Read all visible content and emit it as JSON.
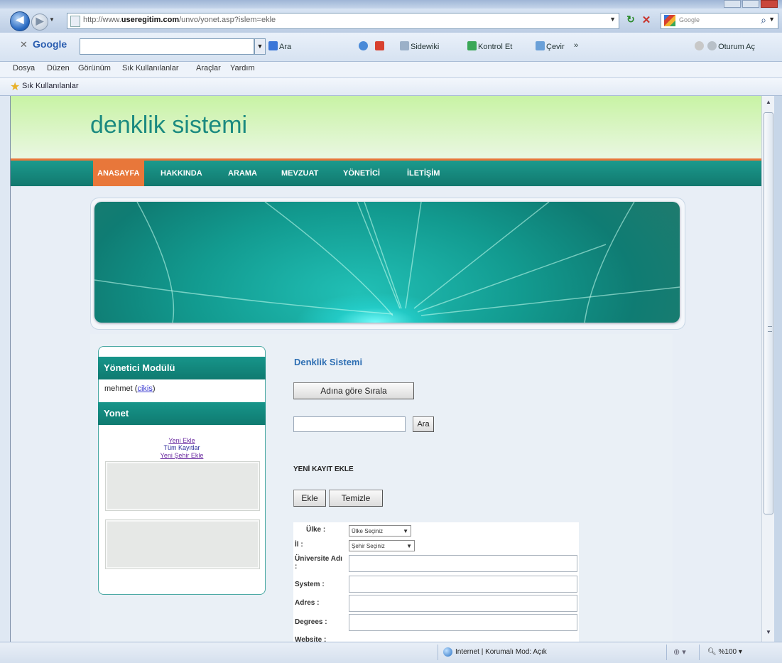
{
  "browser": {
    "window_title": "",
    "address_url_prefix": "http://www.",
    "address_url_domain": "useregitim.com",
    "address_url_rest": "/unvo/yonet.asp?islem=ekle",
    "search_placeholder": "Google",
    "google_toolbar": {
      "logo": "Google",
      "items": [
        "Ara",
        "",
        "Sidewiki",
        "Kontrol Et",
        "Çevir",
        "»"
      ],
      "signin": "Oturum Aç"
    },
    "menu": [
      "Dosya",
      "Düzen",
      "Görünüm",
      "Sık Kullanılanlar",
      "Araçlar",
      "Yardım"
    ],
    "favorites_label": "Sık Kullanılanlar",
    "status": {
      "zone": "Internet | Korumalı Mod: Açık",
      "zoom": "%100"
    }
  },
  "site": {
    "title": "denklik sistemi",
    "nav": [
      "ANASAYFA",
      "HAKKINDA",
      "ARAMA",
      "MEVZUAT",
      "YÖNETİCİ",
      "İLETİŞİM"
    ],
    "active_nav": "ANASAYFA"
  },
  "sidebar": {
    "module_title": "Yönetici Modülü",
    "user": "mehmet",
    "logout": "cikis",
    "manage_title": "Yonet",
    "links": [
      "Yeni Ekle",
      "Tüm Kayıtlar",
      "Yeni Şehir Ekle"
    ]
  },
  "main": {
    "title": "Denklik Sistemi",
    "sort_button": "Adına göre Sırala",
    "search_button": "Ara",
    "new_record_title": "YENİ KAYIT EKLE",
    "add_button": "Ekle",
    "clear_button": "Temizle",
    "form": {
      "country_label": "Ülke :",
      "country_select": "Ülke Seçiniz",
      "city_label": "İl :",
      "city_select": "Şehir Seçiniz",
      "university_label": "Üniversite Adı :",
      "system_label": "System :",
      "address_label": "Adres :",
      "degree_label": "Degrees :",
      "website_label": "Website :"
    }
  },
  "colors": {
    "teal": "#17958a",
    "orange": "#e8773a",
    "title_teal": "#1b8a80",
    "link_blue": "#2e6fb3"
  }
}
